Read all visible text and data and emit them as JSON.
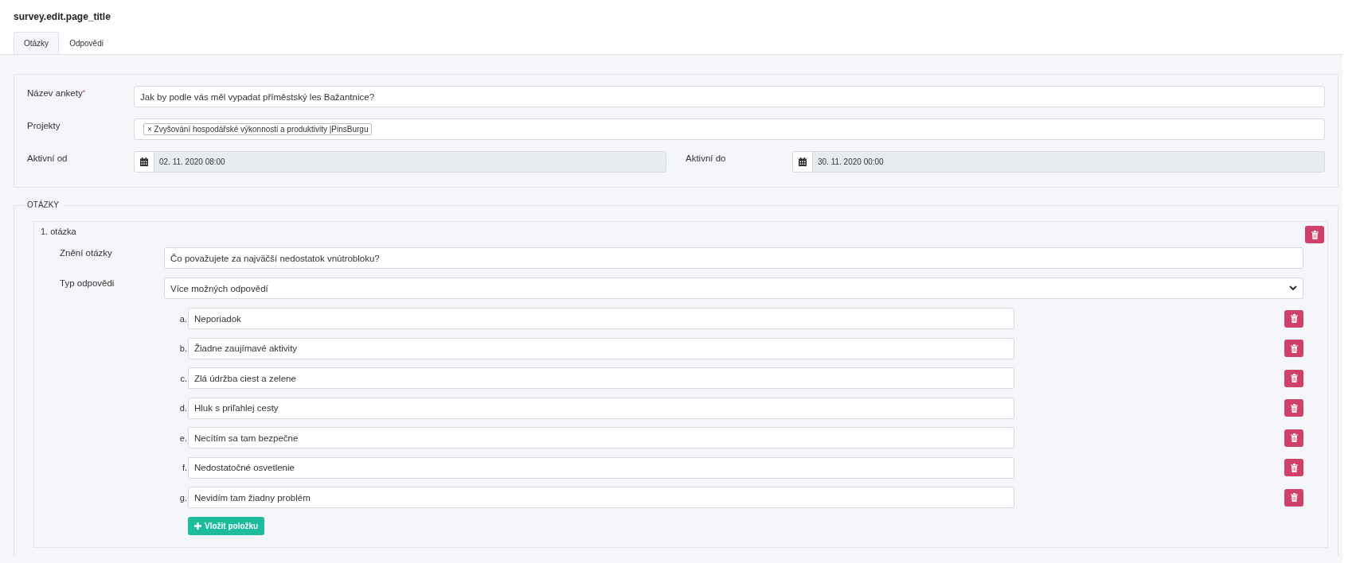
{
  "page_title": "survey.edit.page_title",
  "tabs": [
    {
      "label": "Otázky",
      "selected": true
    },
    {
      "label": "Odpovědi",
      "selected": false
    }
  ],
  "survey": {
    "name_label": "Název ankety",
    "required_mark": "*",
    "name_value": "Jak by podle vás měl vypadat příměstský les Bažantnice?",
    "projects_label": "Projekty",
    "projects": [
      {
        "remove_mark": "×",
        "label": "Zvyšování hospodářské výkonnosti a produktivity |PinsBurgu"
      }
    ],
    "active_from_label": "Aktivní od",
    "active_from": "02. 11. 2020 08:00",
    "active_to_label": "Aktivní do",
    "active_to": "30. 11. 2020 00:00"
  },
  "questions_legend": "OTÁZKY",
  "questions": [
    {
      "title": "1. otázka",
      "text_label": "Znění otázky",
      "text_value": "Čo považujete za najväčší nedostatok vnútrobloku?",
      "type_label": "Typ odpovědi",
      "type_value": "Více možných odpovědí",
      "options": [
        {
          "letter": "a.",
          "value": "Neporiadok"
        },
        {
          "letter": "b.",
          "value": "Žiadne zaujímavé aktivity"
        },
        {
          "letter": "c.",
          "value": "Zlá údržba ciest a zelene"
        },
        {
          "letter": "d.",
          "value": "Hluk s priľahlej cesty"
        },
        {
          "letter": "e.",
          "value": "Necítím sa tam bezpečne"
        },
        {
          "letter": "f.",
          "value": "Nedostatočné osvetlenie"
        },
        {
          "letter": "g.",
          "value": "Nevidím tam žiadny problém"
        }
      ],
      "add_button": "Vložit položku"
    }
  ]
}
